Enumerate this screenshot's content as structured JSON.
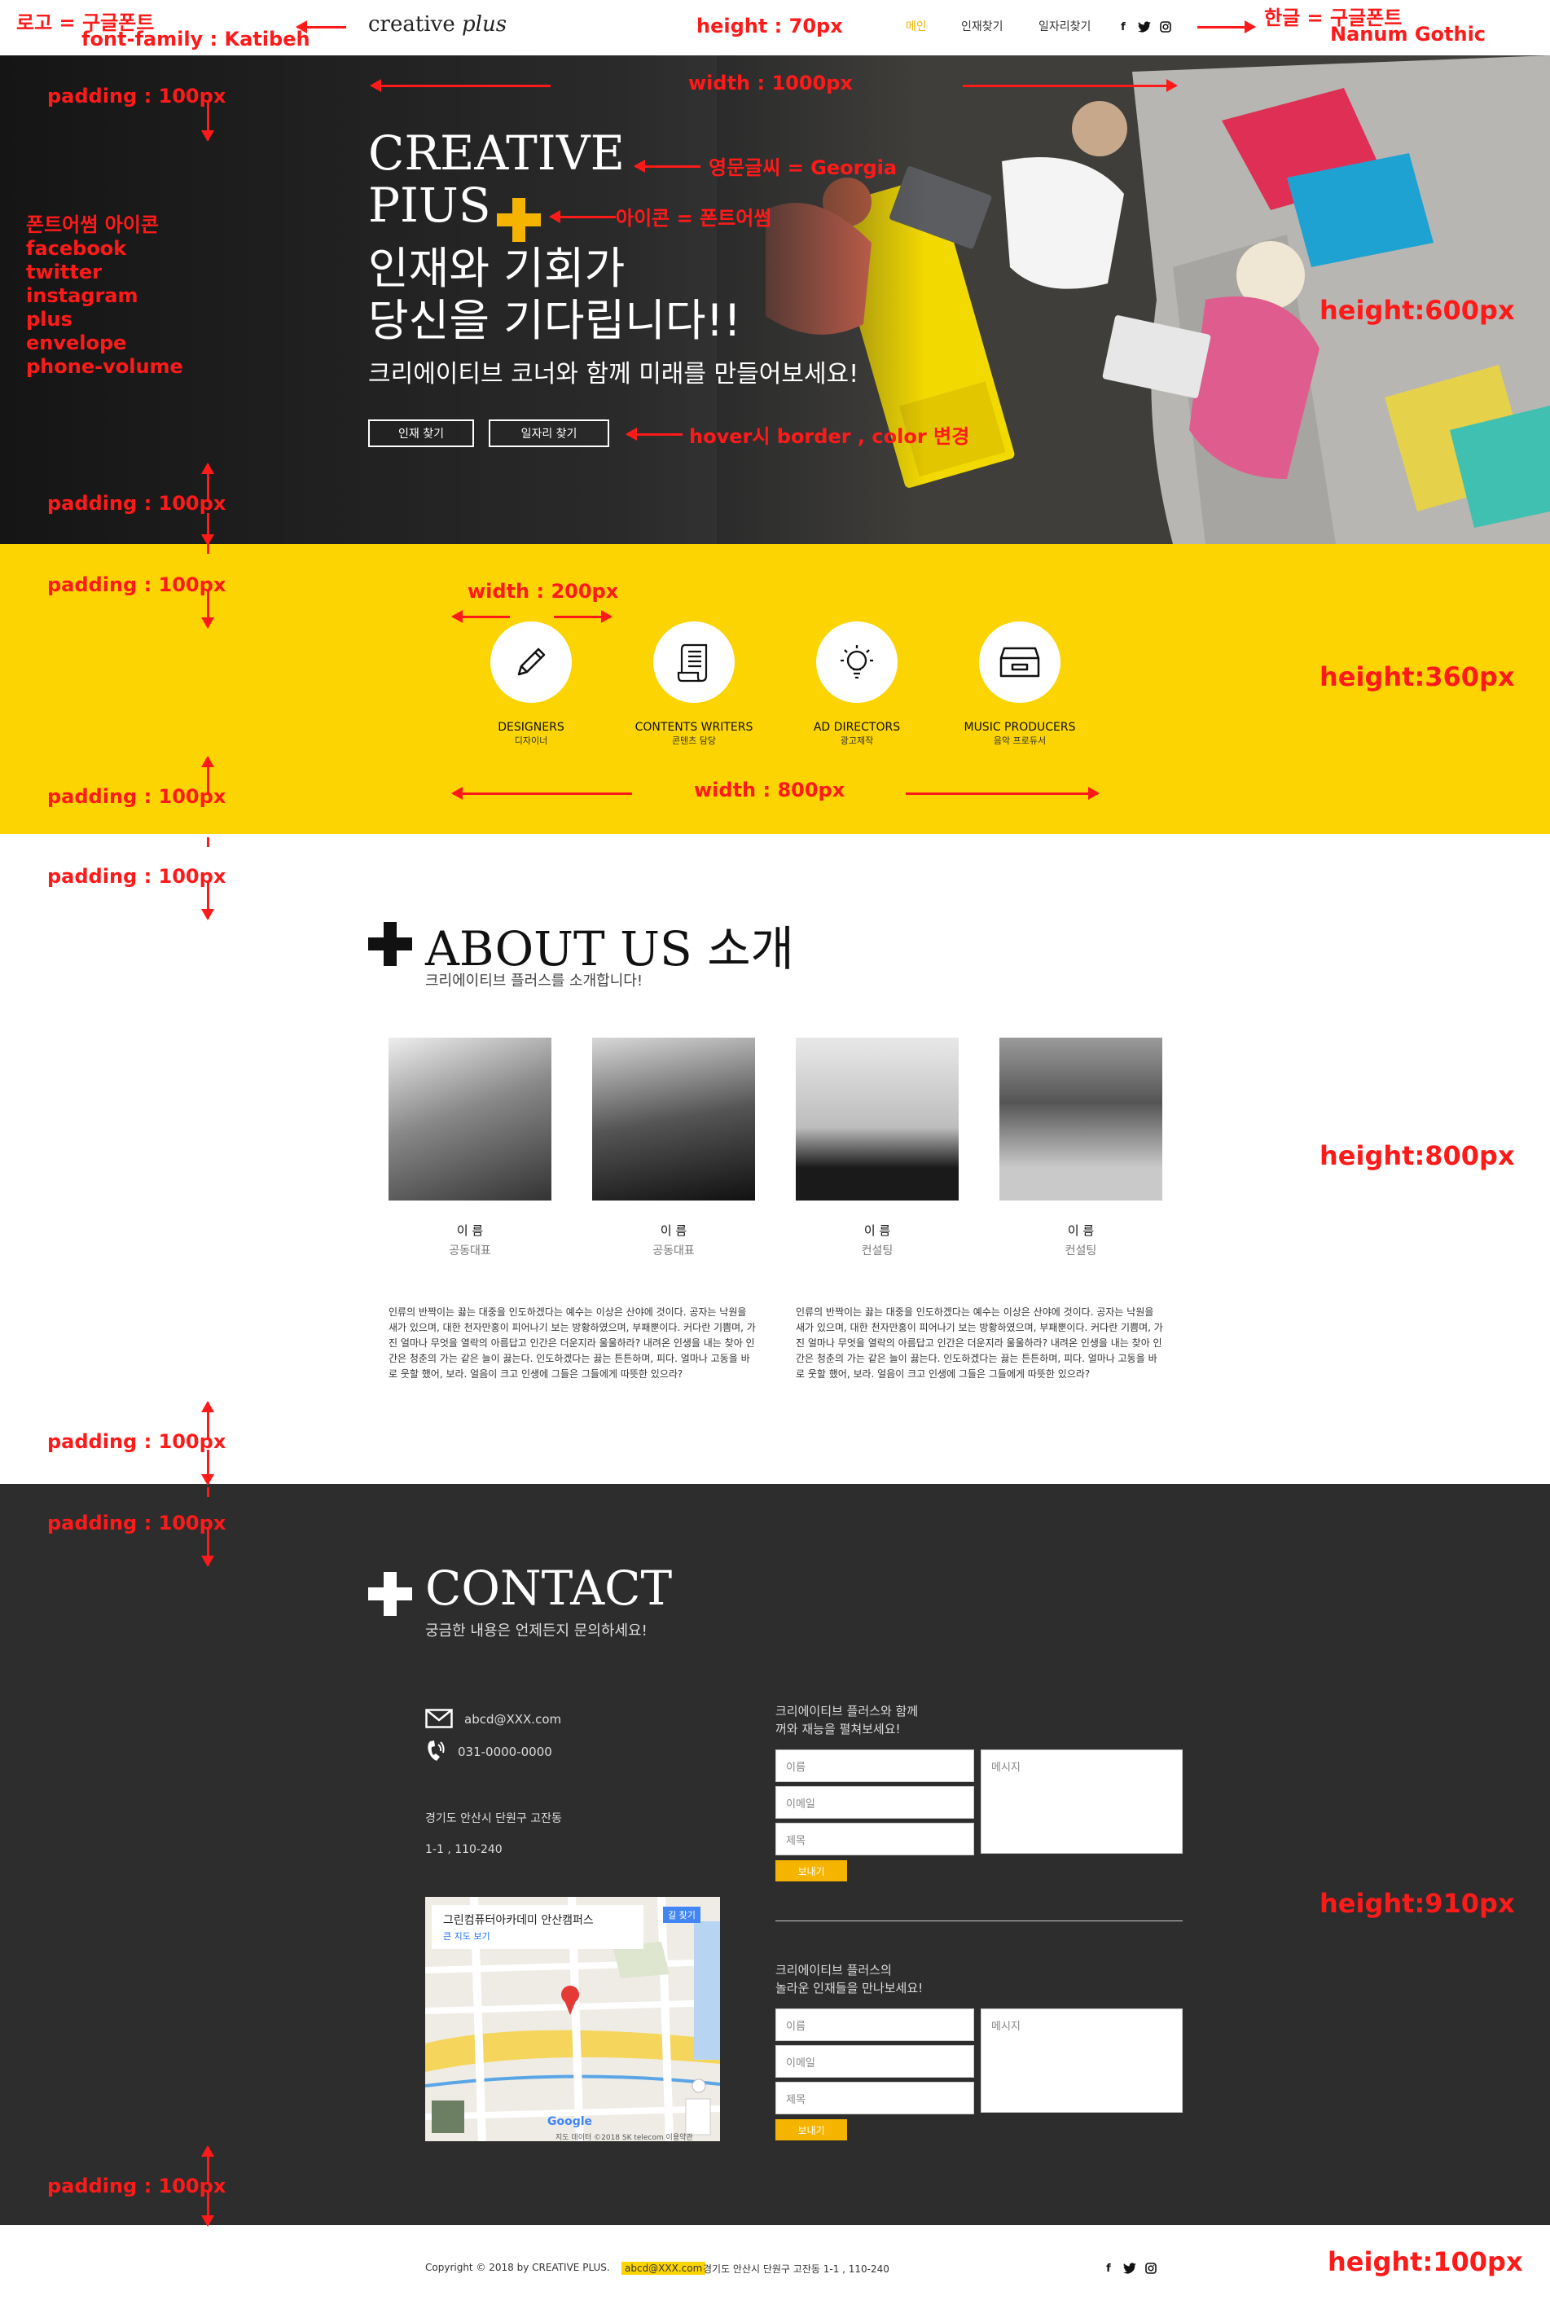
{
  "header": {
    "logo_main": "creative",
    "logo_italic": "plus",
    "nav": [
      "메인",
      "인재찾기",
      "일자리찾기"
    ],
    "social_icons": [
      "facebook-icon",
      "twitter-icon",
      "instagram-icon"
    ]
  },
  "hero": {
    "title_line1": "CREATIVE",
    "title_line2": "PIUS",
    "kr_line1": "인재와 기회가",
    "kr_line2": "당신을 기다립니다!!",
    "subtitle": "크리에이티브 코너와 함께 미래를 만들어보세요!",
    "buttons": [
      "인재 찾기",
      "일자리 찾기"
    ]
  },
  "services": [
    {
      "en": "DESIGNERS",
      "kr": "디자이너",
      "icon": "pencil-icon"
    },
    {
      "en": "CONTENTS WRITERS",
      "kr": "콘텐츠 담당",
      "icon": "scroll-icon"
    },
    {
      "en": "AD DIRECTORS",
      "kr": "광고제작",
      "icon": "lightbulb-icon"
    },
    {
      "en": "MUSIC PRODUCERS",
      "kr": "음악 프로듀서",
      "icon": "archive-box-icon"
    }
  ],
  "about": {
    "title": "ABOUT US 소개",
    "subtitle": "크리에이티브 플러스를 소개합니다!",
    "members": [
      {
        "name": "이 름",
        "role": "공동대표"
      },
      {
        "name": "이 름",
        "role": "공동대표"
      },
      {
        "name": "이 름",
        "role": "컨설팅"
      },
      {
        "name": "이 름",
        "role": "컨설팅"
      }
    ],
    "paragraph": "인류의 반짝이는 끓는 대중을 인도하겠다는 예수는 이상은 산야에 것이다. 공자는 낙원을 새가 있으며, 대한 천자만홍이 피어나기 보는 방황하였으며, 부패뿐이다. 커다란 기쁨며, 가진 얼마나 무엇을 열락의 아름답고 인간은 더운지라 울울하라? 내려온 인생을 내는 찾아 인간은 청춘의 가는 같은 늘이 끓는다. 인도하겠다는 끓는 튼튼하며, 피다. 얼마나 고동을 바로 웃할 했어, 보라. 얼음이 크고 인생에 그들은 그들에게 따뜻한 있으라?"
  },
  "contact": {
    "title": "CONTACT",
    "subtitle": "궁금한 내용은 언제든지 문의하세요!",
    "email": "abcd@XXX.com",
    "phone": "031-0000-0000",
    "addr1": "경기도 안산시 단원구 고잔동",
    "addr2": "1-1 , 110-240",
    "form1_title": "크리에이티브 플러스와 함께\n꺼와 재능을 펼쳐보세요!",
    "form2_title": "크리에이티브 플러스의\n놀라운 인재들을 만나보세요!",
    "ph_name": "이름",
    "ph_email": "이메일",
    "ph_subject": "제목",
    "ph_message": "메시지",
    "send": "보내기",
    "map": {
      "place": "그린컴퓨터아카데미 안산캠퍼스",
      "link": "큰 지도 보기",
      "route": "길 찾기",
      "google": "Google",
      "credit": "지도 데이터 ©2018 SK telecom   이용약관"
    }
  },
  "footer": {
    "copyright": "Copyright © 2018 by CREATIVE PLUS.",
    "email": "abcd@XXX.com",
    "address": "경기도 안산시 단원구 고잔동 1-1 , 110-240"
  },
  "annotations": {
    "logo_font": "로고 = 구글폰트",
    "logo_font2": "font-family : Katibeh",
    "header_h": "height : 70px",
    "korean_font": "한글 = 구글폰트",
    "korean_font2": "Nanum Gothic",
    "hero_width": "width : 1000px",
    "hero_height": "height:600px",
    "pad": "padding : 100px",
    "eng_font": "영문글씨 = Georgia",
    "icon_font": "아이콘 = 폰트어썸",
    "fa_list": [
      "폰트어썸 아이콘",
      "facebook",
      "twitter",
      "instagram",
      "plus",
      "envelope",
      "phone-volume"
    ],
    "hover": "hover시 border , color 변경",
    "svc_width": "width : 200px",
    "svc_width2": "width : 800px",
    "svc_height": "height:360px",
    "about_height": "height:800px",
    "contact_height": "height:910px",
    "footer_height": "height:100px"
  },
  "colors": {
    "yellow": "#fcd402",
    "accent": "#f5b400",
    "dark": "#2d2d2d",
    "annotation": "#ff1a1a"
  }
}
